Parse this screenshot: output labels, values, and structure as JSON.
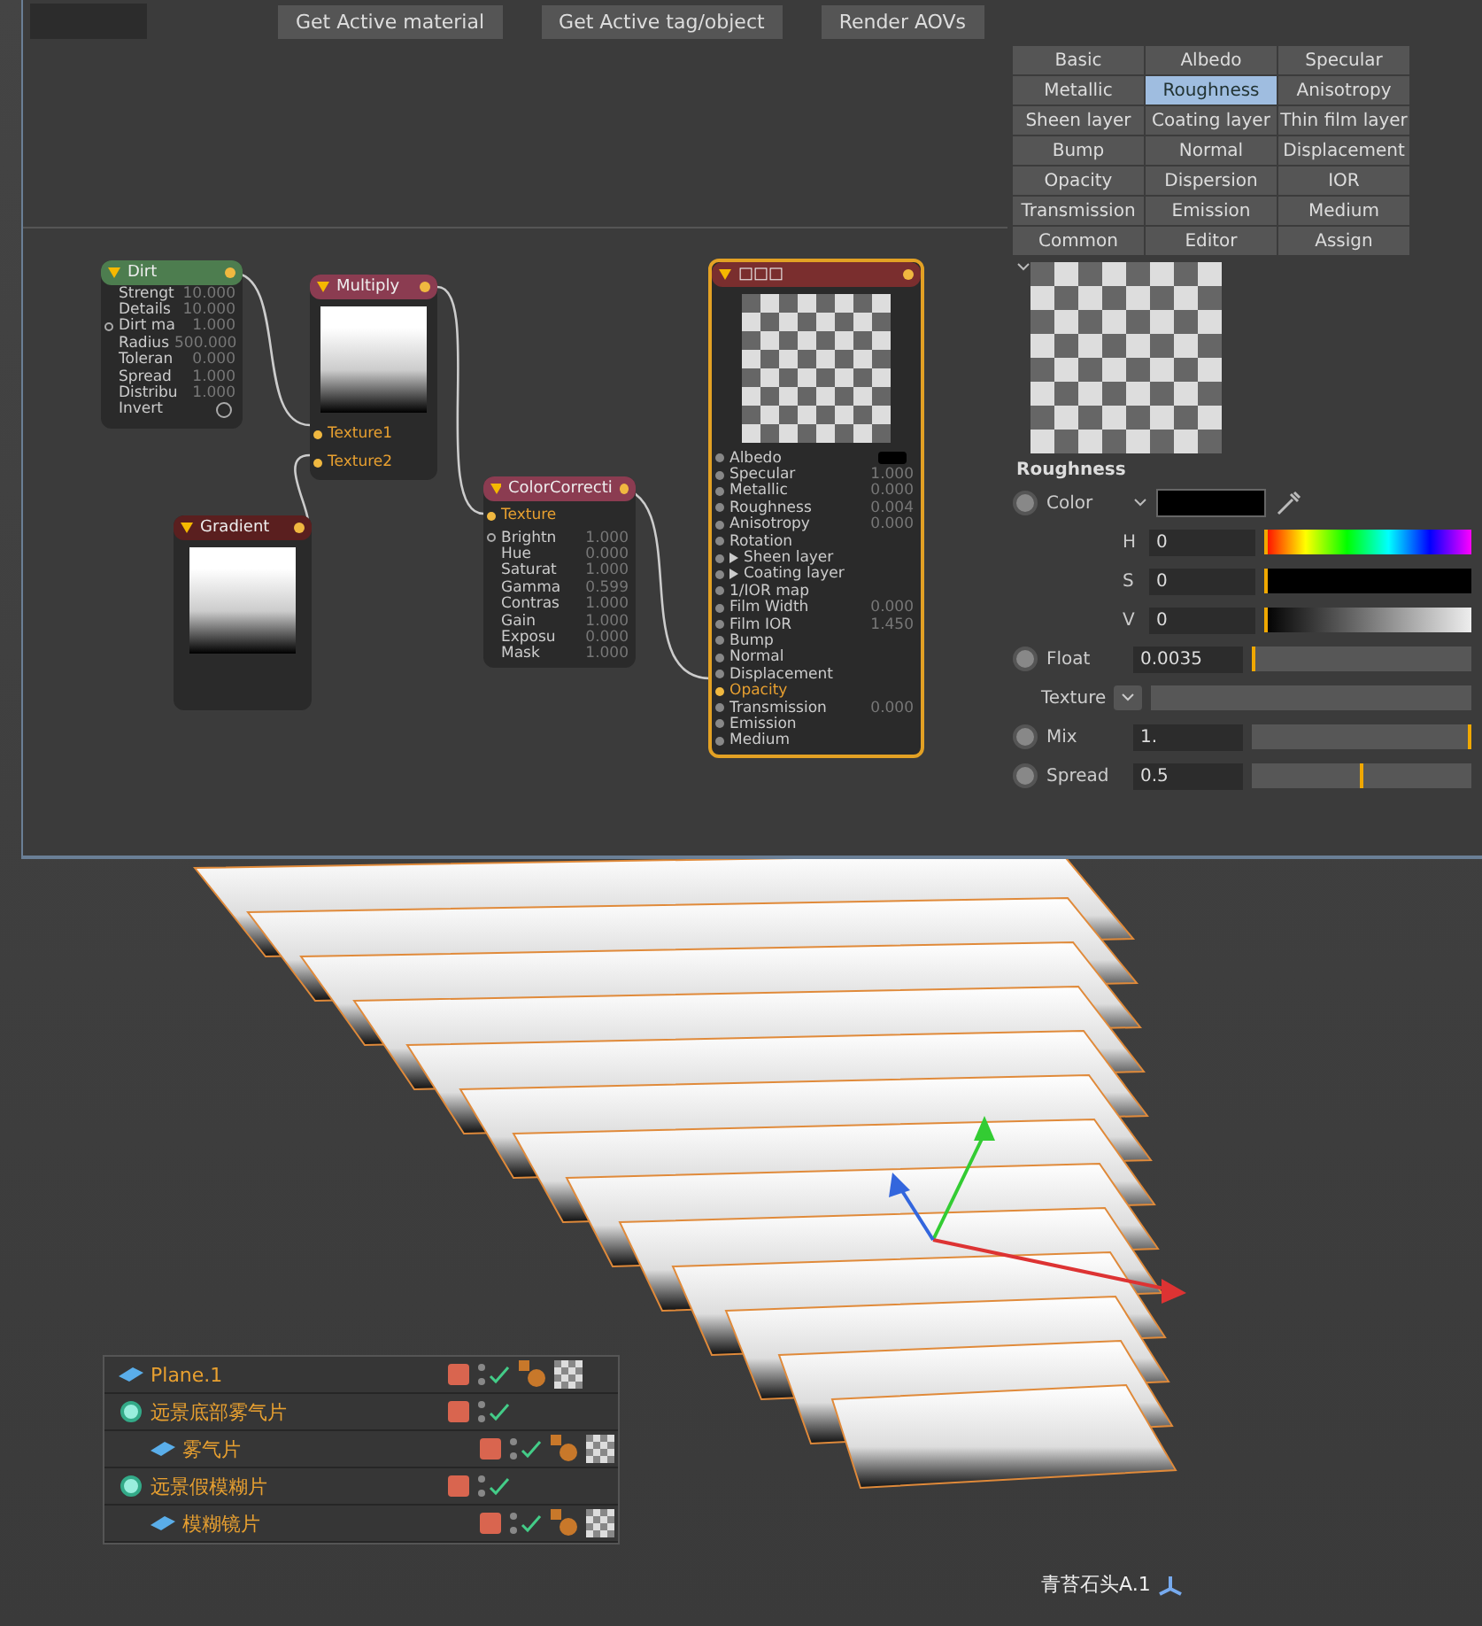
{
  "toolbar": {
    "buttons": [
      "Get Active material",
      "Get Active tag/object",
      "Render AOVs"
    ]
  },
  "nodes": [
    {
      "kind": "dirt",
      "title": "Dirt",
      "params": [
        {
          "name": "Strengt",
          "value": "10.000",
          "socket": false
        },
        {
          "name": "Details",
          "value": "10.000",
          "socket": false
        },
        {
          "name": "Dirt ma",
          "value": "1.000",
          "socket": true
        },
        {
          "name": "Radius",
          "value": "500.000",
          "socket": false
        },
        {
          "name": "Toleran",
          "value": "0.000",
          "socket": false
        },
        {
          "name": "Spread",
          "value": "1.000",
          "socket": false
        },
        {
          "name": "Distribu",
          "value": "1.000",
          "socket": false
        },
        {
          "name": "Invert",
          "kind": "toggle",
          "checked": false,
          "socket": false
        }
      ]
    },
    {
      "kind": "multiply",
      "title": "Multiply",
      "inputs": [
        "Texture1",
        "Texture2"
      ]
    },
    {
      "kind": "gradient",
      "title": "Gradient"
    },
    {
      "kind": "colorcorrection",
      "title": "ColorCorrecti",
      "inputs": [
        "Texture"
      ],
      "params": [
        {
          "name": "Brightn",
          "value": "1.000",
          "socket": true
        },
        {
          "name": "Hue",
          "value": "0.000",
          "socket": false
        },
        {
          "name": "Saturat",
          "value": "1.000",
          "socket": false
        },
        {
          "name": "Gamma",
          "value": "0.599",
          "socket": false
        },
        {
          "name": "Contras",
          "value": "1.000",
          "socket": false
        },
        {
          "name": "Gain",
          "value": "1.000",
          "socket": false
        },
        {
          "name": "Exposu",
          "value": "0.000",
          "socket": false
        },
        {
          "name": "Mask",
          "value": "1.000",
          "socket": false
        }
      ]
    },
    {
      "kind": "material",
      "title": "□□□",
      "params": [
        {
          "name": "Albedo",
          "kind": "color"
        },
        {
          "name": "Specular",
          "value": "1.000"
        },
        {
          "name": "Metallic",
          "value": "0.000"
        },
        {
          "name": "Roughness",
          "value": "0.004"
        },
        {
          "name": "Anisotropy",
          "value": "0.000"
        },
        {
          "name": "Rotation"
        },
        {
          "name": "Sheen layer",
          "kind": "group"
        },
        {
          "name": "Coating layer",
          "kind": "group"
        },
        {
          "name": "1/IOR map"
        },
        {
          "name": "Film Width",
          "value": "0.000"
        },
        {
          "name": "Film IOR",
          "value": "1.450"
        },
        {
          "name": "Bump"
        },
        {
          "name": "Normal"
        },
        {
          "name": "Displacement"
        },
        {
          "name": "Opacity",
          "connected": true
        },
        {
          "name": "Transmission",
          "value": "0.000"
        },
        {
          "name": "Emission"
        },
        {
          "name": "Medium"
        }
      ]
    }
  ],
  "tabs": [
    {
      "label": "Basic",
      "selected": false
    },
    {
      "label": "Albedo",
      "selected": false
    },
    {
      "label": "Specular",
      "selected": false
    },
    {
      "label": "Metallic",
      "selected": false
    },
    {
      "label": "Roughness",
      "selected": true
    },
    {
      "label": "Anisotropy",
      "selected": false
    },
    {
      "label": "Sheen layer",
      "selected": false
    },
    {
      "label": "Coating layer",
      "selected": false
    },
    {
      "label": "Thin film layer",
      "selected": false
    },
    {
      "label": "Bump",
      "selected": false
    },
    {
      "label": "Normal",
      "selected": false
    },
    {
      "label": "Displacement",
      "selected": false
    },
    {
      "label": "Opacity",
      "selected": false
    },
    {
      "label": "Dispersion",
      "selected": false
    },
    {
      "label": "IOR",
      "selected": false
    },
    {
      "label": "Transmission",
      "selected": false
    },
    {
      "label": "Emission",
      "selected": false
    },
    {
      "label": "Medium",
      "selected": false
    },
    {
      "label": "Common",
      "selected": false
    },
    {
      "label": "Editor",
      "selected": false
    },
    {
      "label": "Assign",
      "selected": false
    }
  ],
  "section": {
    "title": "Roughness",
    "color": {
      "label": "Color",
      "channels": [
        {
          "label": "H",
          "value": "0",
          "level": 0
        },
        {
          "label": "S",
          "value": "0",
          "level": 0
        },
        {
          "label": "V",
          "value": "0",
          "level": 0
        }
      ]
    },
    "float": {
      "label": "Float",
      "value": "0.0035",
      "level": 0.0035
    },
    "texture": {
      "label": "Texture"
    },
    "mix": {
      "label": "Mix",
      "value": "1.",
      "level": 1
    },
    "spread": {
      "label": "Spread",
      "value": "0.5",
      "level": 0.5
    }
  },
  "objects": [
    {
      "name": "Plane.1",
      "kind": "plane",
      "tags": true
    },
    {
      "name": "远景底部雾气片",
      "kind": "null",
      "tags": false,
      "children": [
        {
          "name": "雾气片",
          "kind": "plane",
          "tags": true
        }
      ]
    },
    {
      "name": "远景假模糊片",
      "kind": "null",
      "tags": false,
      "children": [
        {
          "name": "模糊镜片",
          "kind": "plane",
          "tags": true
        }
      ]
    }
  ],
  "viewport_label": "青苔石头A.1"
}
